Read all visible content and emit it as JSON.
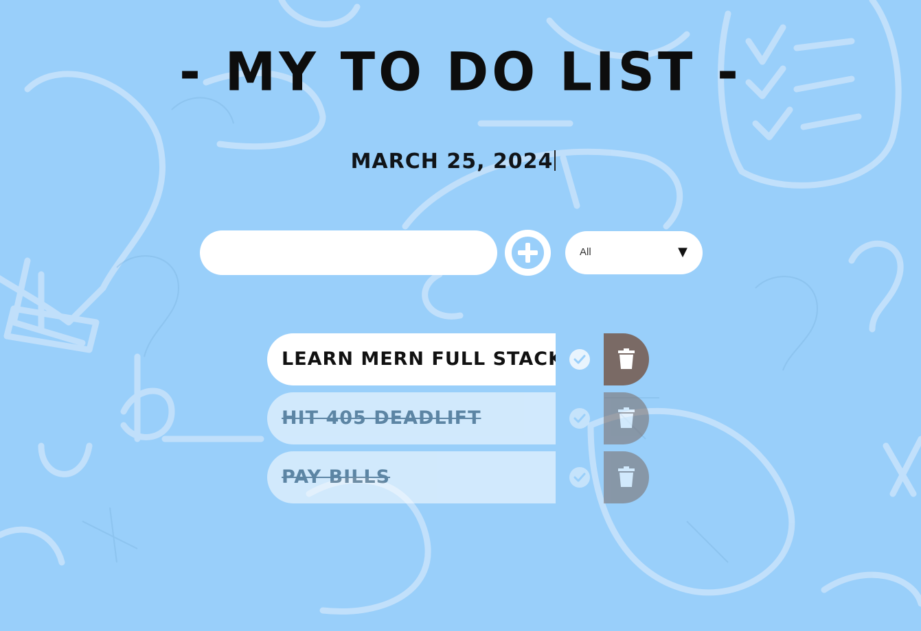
{
  "app": {
    "title": "- MY TO DO LIST -",
    "date": "March 25, 2024"
  },
  "colors": {
    "background": "#99cffa",
    "accent": "#99cffa",
    "trash": "#7a6a65"
  },
  "form": {
    "input_value": "",
    "add_icon": "plus-circle-icon",
    "filter": {
      "selected": "All",
      "arrow_icon": "caret-down-icon"
    }
  },
  "todos": [
    {
      "text": "Learn MERN full stack",
      "completed": false
    },
    {
      "text": "Hit 405 deadlift",
      "completed": true
    },
    {
      "text": "Pay bills",
      "completed": true
    }
  ]
}
